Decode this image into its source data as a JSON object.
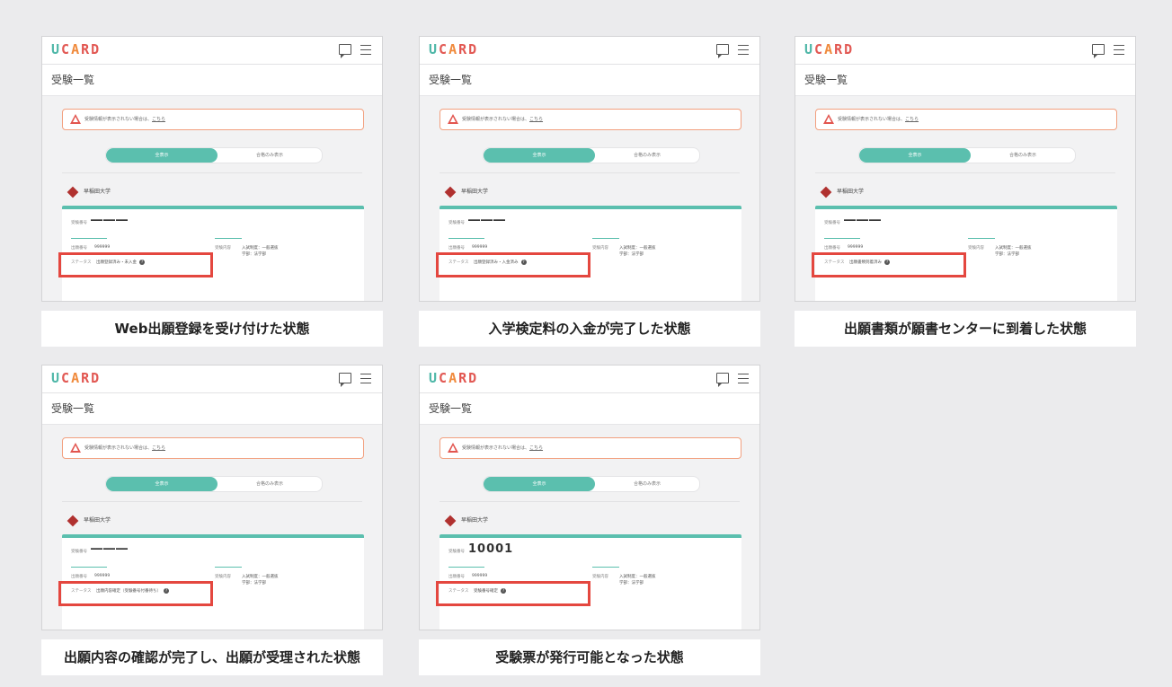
{
  "app": {
    "logo_letters": [
      "U",
      "C",
      "A",
      "R",
      "D"
    ],
    "page_title": "受験一覧",
    "alert_text": "受験情報が表示されない場合は、",
    "alert_link": "こちら",
    "toggle_active": "全表示",
    "toggle_inactive": "合格のみ表示",
    "university": "早稲田大学",
    "exam_number_label": "受験番号",
    "application_number_label": "出願番号",
    "application_number": "999999",
    "exam_content_label": "受験内容",
    "exam_content_line1": "入試制度：一般選抜",
    "exam_content_line2": "学部：法学部",
    "status_label": "ステータス"
  },
  "panels": [
    {
      "exam_number": "―――",
      "status": "出願登録済み・未入金",
      "caption": "Web出願登録を受け付けた状態"
    },
    {
      "exam_number": "―――",
      "status": "出願登録済み・入金済み",
      "caption": "入学検定料の入金が完了した状態"
    },
    {
      "exam_number": "―――",
      "status": "出願書類到着済み",
      "caption": "出願書類が願書センターに到着した状態"
    },
    {
      "exam_number": "―――",
      "status": "出願内容確定（受験番号付番待ち）",
      "caption": "出願内容の確認が完了し、出願が受理された状態"
    },
    {
      "exam_number": "10001",
      "status": "受験番号確定",
      "caption": "受験票が発行可能となった状態"
    }
  ],
  "colors": {
    "accent": "#5bbfae",
    "highlight": "#e4473f",
    "alert_border": "#f2a07f",
    "background": "#ebebed"
  }
}
